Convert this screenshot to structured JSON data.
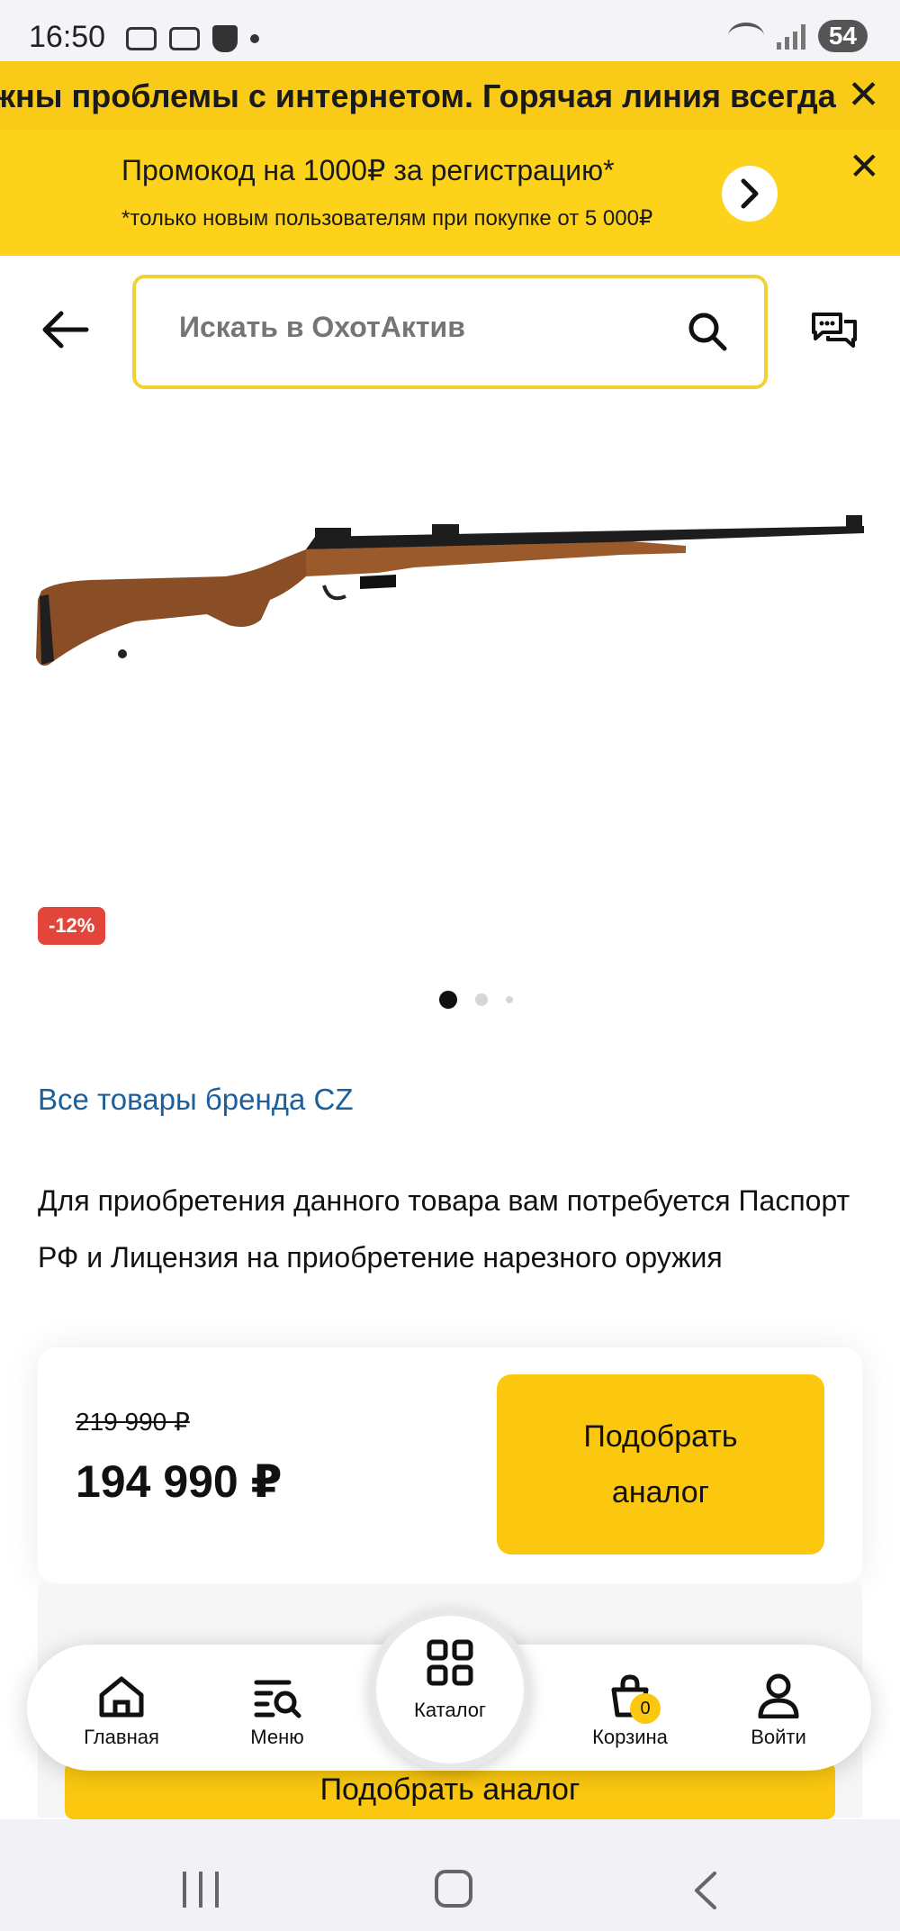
{
  "status_bar": {
    "time": "16:50",
    "battery": "54"
  },
  "ticker": {
    "text": "ожны проблемы с интернетом. Горячая линия всегда",
    "close": "✕"
  },
  "promo": {
    "title": "Промокод на 1000₽ за регистрацию*",
    "subtitle": "*только новым пользователям при покупке от 5 000₽",
    "close": "✕"
  },
  "search": {
    "placeholder": "Искать в ОхотАктив"
  },
  "product": {
    "discount_badge": "-12%",
    "gallery_count": 3,
    "gallery_active_index": 0,
    "brand_link": "Все товары бренда CZ",
    "license_notice": "Для приобретения данного товара вам потребуется Паспорт РФ и Лицензия на приобретение нарезного оружия",
    "old_price": "219 990 ₽",
    "price": "194 990 ₽",
    "analog_button_line1": "Подобрать",
    "analog_button_line2": "аналог",
    "bottom_analog_button": "Подобрать аналог"
  },
  "tabbar": {
    "home": "Главная",
    "menu": "Меню",
    "catalog": "Каталог",
    "cart": "Корзина",
    "cart_count": "0",
    "login": "Войти"
  },
  "colors": {
    "accent": "#fcc80f",
    "link": "#1d5f98",
    "badge": "#e2463b"
  }
}
